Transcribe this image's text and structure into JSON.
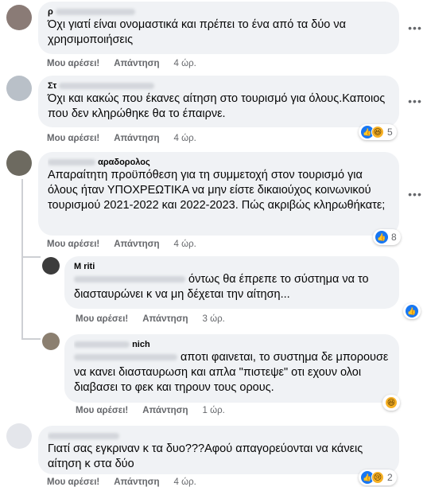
{
  "actions": {
    "like": "Μου αρέσει!",
    "reply": "Απάντηση"
  },
  "comments": [
    {
      "name_visible": "ρ",
      "text": "Όχι γιατί είναι ονομαστικά και πρέπει το ένα από τα δύο να χρησιμοποιήσεις",
      "time": "4 ώρ."
    },
    {
      "name_visible": "Στ",
      "text": "Όχι και κακώς που έκανες αίτηση στο τουρισμό για όλους.Καποιος που δεν κληρώθηκε θα το έπαιρνε.",
      "time": "4 ώρ.",
      "reaction_count": "5"
    },
    {
      "name_visible": "αραδορολος",
      "text": "Απαραίτητη προϋπόθεση για τη συμμετοχή στον τουρισμό για όλους ήταν ΥΠΟΧΡΕΩΤΙΚΑ να μην είστε δικαιούχος κοινωνικού τουρισμού 2021-2022 και 2022-2023. Πώς ακριβώς κληρωθήκατε;",
      "time": "4 ώρ.",
      "reaction_count": "8"
    },
    {
      "name_visible": "M           riti",
      "text": "όντως θα έπρεπε το σύστημα να το διασταυρώνει κ να μη δέχεται την αίτηση...",
      "time": "3 ώρ."
    },
    {
      "name_visible": "nich",
      "text": "αποτι φαινεται, το συστημα δε μπορουσε να κανει διασταυρωση και απλα \"πιστεψε\" οτι εχουν ολοι διαβασει το φεκ και τηρουν τους ορους.",
      "time": "1 ώρ."
    },
    {
      "name_visible": "",
      "text": "Γιατί σας εγκριναν κ τα δυο???Αφού απαγορεύονται να κάνεις αίτηση κ στα δύο",
      "time": "4 ώρ.",
      "reaction_count": "2"
    }
  ],
  "colors": {
    "bubble": "#f0f2f5",
    "meta": "#65676b",
    "like": "#1877f2",
    "haha": "#f7b125"
  }
}
